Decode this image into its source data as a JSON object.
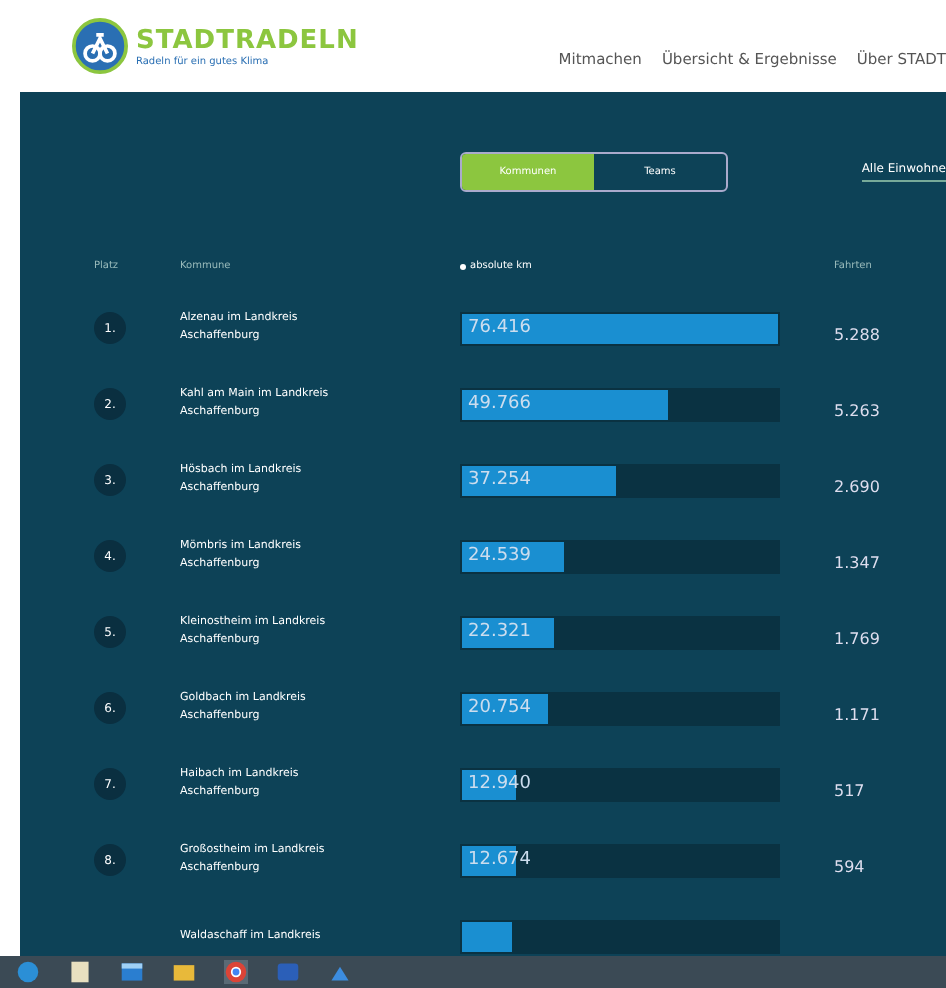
{
  "header": {
    "logo_title": "STADTRADELN",
    "logo_subtitle": "Radeln für ein gutes Klima",
    "nav": [
      "Mitmachen",
      "Übersicht & Ergebnisse",
      "Über STADT"
    ]
  },
  "toggle": [
    {
      "label": "Kommunen",
      "selected": true
    },
    {
      "label": "Teams",
      "selected": false
    }
  ],
  "filter": {
    "label": "Alle Einwohne"
  },
  "table": {
    "columns": [
      "Platz",
      "Kommune",
      "absolute km",
      "Fahrten"
    ],
    "rows": [
      {
        "rank": "1.",
        "name": "Alzenau im Landkreis Aschaffenburg",
        "km": "76.416",
        "level": 1,
        "trips": "5.288"
      },
      {
        "rank": "2.",
        "name": "Kahl am Main im Landkreis Aschaffenburg",
        "km": "49.766",
        "level": 0.65,
        "trips": "5.263"
      },
      {
        "rank": "3.",
        "name": "Hösbach im Landkreis Aschaffenburg",
        "km": "37.254",
        "level": 0.49,
        "trips": "2.690"
      },
      {
        "rank": "4.",
        "name": "Mömbris im Landkreis Aschaffenburg",
        "km": "24.539",
        "level": 0.32,
        "trips": "1.347"
      },
      {
        "rank": "5.",
        "name": "Kleinostheim im Landkreis Aschaffenburg",
        "km": "22.321",
        "level": 0.29,
        "trips": "1.769"
      },
      {
        "rank": "6.",
        "name": "Goldbach im Landkreis Aschaffenburg",
        "km": "20.754",
        "level": 0.27,
        "trips": "1.171"
      },
      {
        "rank": "7.",
        "name": "Haibach im Landkreis Aschaffenburg",
        "km": "12.940",
        "level": 0.17,
        "trips": "517"
      },
      {
        "rank": "8.",
        "name": "Großostheim im Landkreis Aschaffenburg",
        "km": "12.674",
        "level": 0.17,
        "trips": "594"
      },
      {
        "name": "Waldaschaff im Landkreis",
        "level": 0.16
      }
    ]
  }
}
